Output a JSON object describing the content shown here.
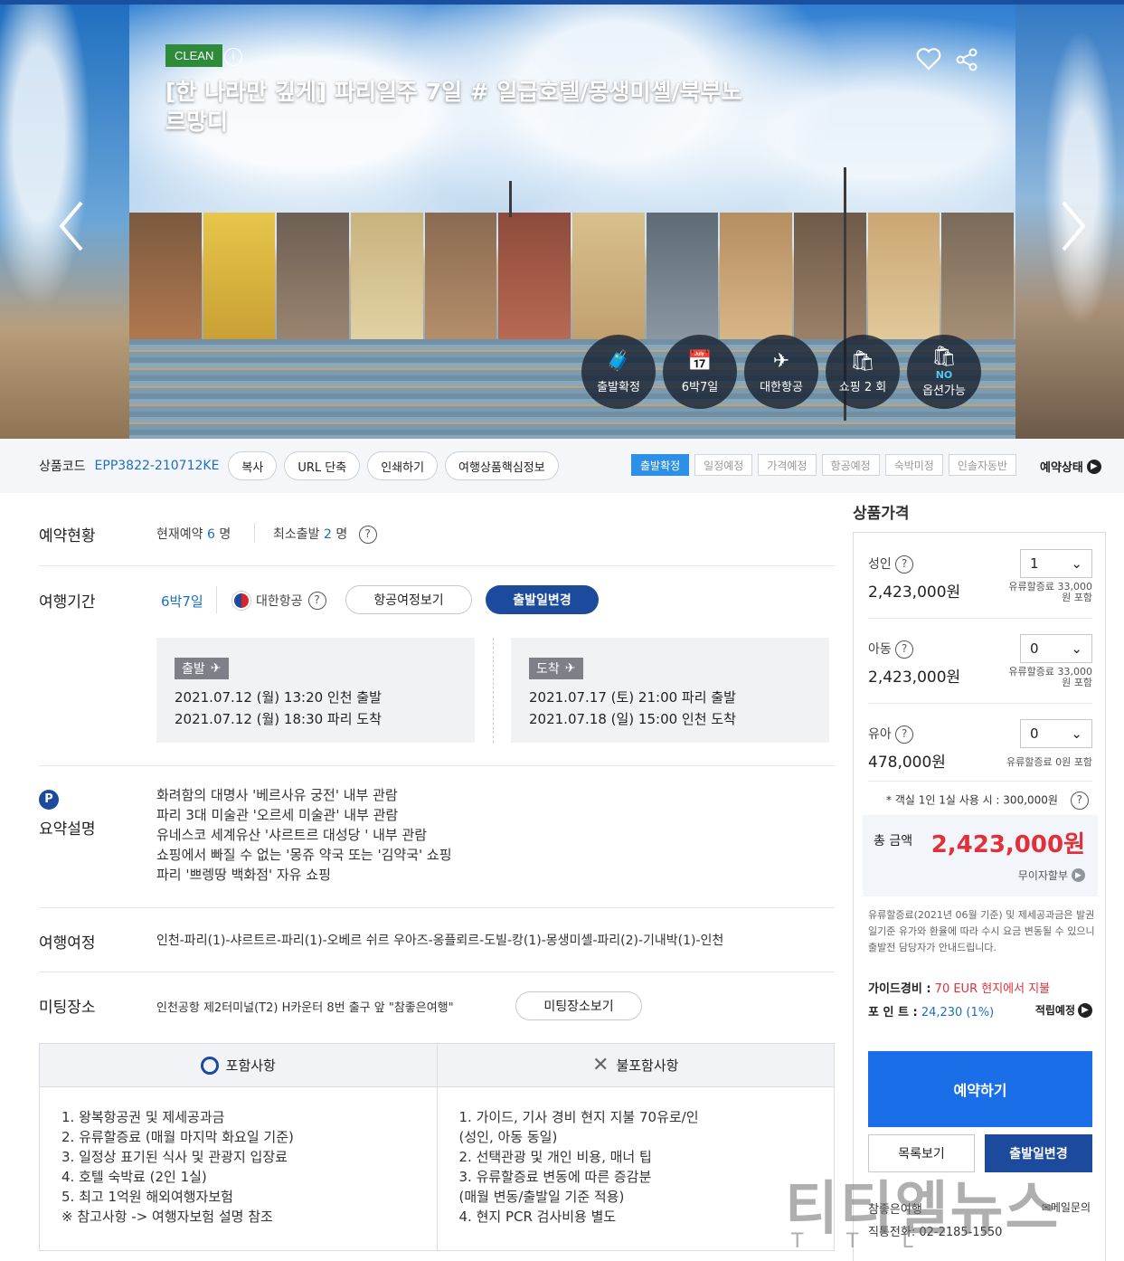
{
  "hero": {
    "clean_badge": "CLEAN",
    "info_icon_text": "i",
    "title": "[한 나라만 깊게] 파리일주 7일 # 일급호텔/몽생미셸/북부노르망디",
    "circles": [
      {
        "icon": "suitcase-icon",
        "glyph": "🧳",
        "label": "출발확정"
      },
      {
        "icon": "calendar-icon",
        "glyph": "📅",
        "label": "6박7일"
      },
      {
        "icon": "airplane-icon",
        "glyph": "✈",
        "label": "대한항공"
      },
      {
        "icon": "shopping-bag-icon",
        "glyph": "🛍",
        "label": "쇼핑 2 회"
      },
      {
        "icon": "no-option-bag-icon",
        "glyph": "🛍",
        "no": "NO",
        "label": "옵션가능"
      }
    ]
  },
  "codebar": {
    "label": "상품코드",
    "code": "EPP3822-210712KE",
    "buttons": [
      "복사",
      "URL 단축",
      "인쇄하기",
      "여행상품핵심정보"
    ],
    "status_tags": [
      "출발확정",
      "일정예정",
      "가격예정",
      "항공예정",
      "숙박미정",
      "인솔자동반"
    ],
    "status_label": "예약상태"
  },
  "booking": {
    "title": "예약현황",
    "current_label": "현재예약",
    "current_count": "6",
    "current_unit": "명",
    "min_label": "최소출발",
    "min_count": "2",
    "min_unit": "명"
  },
  "period": {
    "title": "여행기간",
    "duration": "6박7일",
    "airline": "대한항공",
    "btn_itinerary": "항공여정보기",
    "btn_change": "출발일변경",
    "depart": {
      "tag": "출발",
      "line1": "2021.07.12 (월) 13:20 인천 출발",
      "line2": "2021.07.12 (월) 18:30 파리 도착"
    },
    "arrive": {
      "tag": "도착",
      "line1": "2021.07.17 (토) 21:00 파리 출발",
      "line2": "2021.07.18 (일) 15:00 인천 도착"
    }
  },
  "summary": {
    "badge": "P",
    "title": "요약설명",
    "lines": [
      "화려함의 대명사 '베르사유 궁전' 내부 관람",
      "파리 3대 미술관 '오르세 미술관' 내부 관람",
      "유네스코 세계유산 '샤르트르 대성당 ' 내부 관람",
      "쇼핑에서 빠질 수 없는 '몽쥬 약국 또는 '김약국' 쇼핑",
      "파리 '쁘렝땅 백화점' 자유 쇼핑"
    ]
  },
  "route": {
    "title": "여행여정",
    "text": "인천-파리(1)-샤르트르-파리(1)-오베르 쉬르 우아즈-옹플뢰르-도빌-캉(1)-몽생미셸-파리(2)-기내박(1)-인천"
  },
  "meeting": {
    "title": "미팅장소",
    "text": "인천공항 제2터미널(T2) H카운터 8번 출구 앞 \"참좋은여행\"",
    "btn": "미팅장소보기"
  },
  "includes": {
    "included_title": "포함사항",
    "excluded_title": "불포함사항",
    "included": [
      "1. 왕복항공권 및 제세공과금",
      "2. 유류할증료 (매월 마지막 화요일 기준)",
      "3. 일정상 표기된 식사 및 관광지 입장료",
      "4. 호텔 숙박료 (2인 1실)",
      "5. 최고 1억원 해외여행자보험",
      "※ 참고사항 -> 여행자보험 설명 참조"
    ],
    "excluded": [
      "1. 가이드, 기사 경비 현지 지불 70유로/인",
      "(성인, 아동 동일)",
      "2. 선택관광 및 개인 비용, 매너 팁",
      "3. 유류할증료 변동에 따른 증감분",
      "(매월 변동/출발일 기준 적용)",
      "4. 현지 PCR 검사비용 별도"
    ]
  },
  "price": {
    "title": "상품가격",
    "adult": {
      "label": "성인",
      "price": "2,423,000원",
      "qty": "1",
      "note1": "유류할증료 33,000",
      "note2": "원 포함"
    },
    "child": {
      "label": "아동",
      "price": "2,423,000원",
      "qty": "0",
      "note1": "유류할증료 33,000",
      "note2": "원 포함"
    },
    "infant": {
      "label": "유아",
      "price": "478,000원",
      "qty": "0",
      "note1": "유류할증료 0원 포함"
    },
    "room_note": "* 객실 1인 1실 사용 시 : 300,000원",
    "total_label": "총 금액",
    "total_value": "2,423,000원",
    "installment": "무이자할부",
    "fuel_note": "유류할증료(2021년 06월 기준) 및 제세공과금은 발권일기준 유가와 환율에 따라 수시 요금 변동될 수 있으니 출발전 담당자가 안내드립니다.",
    "guide_label": "가이드경비 :",
    "guide_value": "70 EUR 현지에서 지불",
    "points_label": "포 인 트 :",
    "points_value": "24,230 (1%)",
    "accum_label": "적립예정",
    "reserve_btn": "예약하기",
    "list_btn": "목록보기",
    "change_btn": "출발일변경",
    "agency": "참좋은여행",
    "mail": "✉메일문의",
    "phone": "직통전화: 02-2185-1550"
  },
  "watermark": {
    "main": "티티엘뉴스",
    "sub": "TTL"
  }
}
